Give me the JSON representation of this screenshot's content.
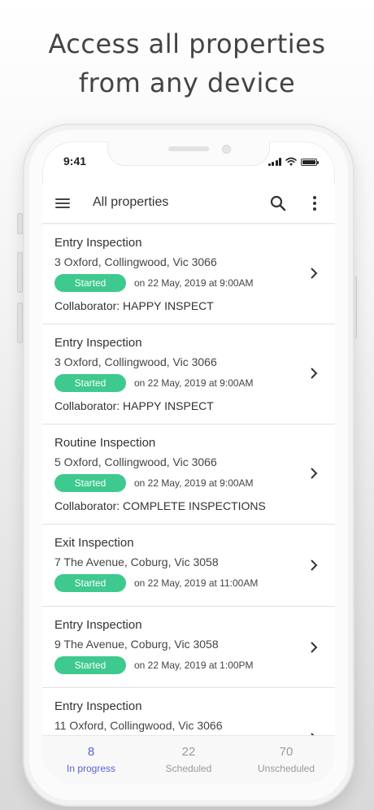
{
  "headline": {
    "line1": "Access all properties",
    "line2": "from any device"
  },
  "status_bar": {
    "time": "9:41"
  },
  "app_bar": {
    "title": "All properties"
  },
  "badge_color": "#3ec98e",
  "accent_color": "#5a62cf",
  "inspections": [
    {
      "type": "Entry Inspection",
      "address": "3 Oxford, Collingwood, Vic 3066",
      "status": "Started",
      "date": "on 22 May, 2019 at 9:00AM",
      "collaborator": "Collaborator: HAPPY INSPECT"
    },
    {
      "type": "Entry Inspection",
      "address": "3 Oxford, Collingwood, Vic 3066",
      "status": "Started",
      "date": "on 22 May, 2019 at 9:00AM",
      "collaborator": "Collaborator: HAPPY INSPECT"
    },
    {
      "type": "Routine Inspection",
      "address": "5 Oxford, Collingwood, Vic 3066",
      "status": "Started",
      "date": "on 22 May, 2019 at 9:00AM",
      "collaborator": "Collaborator: COMPLETE INSPECTIONS"
    },
    {
      "type": "Exit Inspection",
      "address": "7 The Avenue, Coburg, Vic 3058",
      "status": "Started",
      "date": "on 22 May, 2019 at 11:00AM"
    },
    {
      "type": "Entry Inspection",
      "address": "9 The Avenue, Coburg, Vic 3058",
      "status": "Started",
      "date": "on 22 May, 2019 at 1:00PM"
    },
    {
      "type": "Entry Inspection",
      "address": "11 Oxford, Collingwood, Vic 3066"
    }
  ],
  "tabs": [
    {
      "count": "8",
      "label": "In progress",
      "active": true
    },
    {
      "count": "22",
      "label": "Scheduled"
    },
    {
      "count": "70",
      "label": "Unscheduled"
    }
  ],
  "icons": {
    "menu": "menu-icon",
    "search": "search-icon",
    "more": "more-vert-icon",
    "chevron": "chevron-right-icon"
  }
}
